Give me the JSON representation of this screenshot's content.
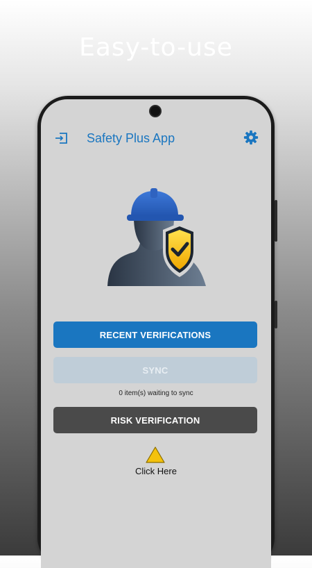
{
  "promo": {
    "headline": "Easy-to-use"
  },
  "app": {
    "title": "Safety Plus App"
  },
  "icons": {
    "left_action": "logout-icon",
    "right_action": "gear-icon",
    "hero": "worker-shield-icon",
    "alert": "warning-icon"
  },
  "buttons": {
    "recent_verifications": "RECENT VERIFICATIONS",
    "sync": "SYNC",
    "risk_verification": "RISK VERIFICATION"
  },
  "sync_status": "0 item(s) waiting to sync",
  "alert": {
    "label": "Click Here"
  },
  "colors": {
    "accent": "#1a76c0",
    "sync_disabled": "#bfcdd8",
    "risk_button": "#4a4a4a",
    "screen_bg": "#d4d4d4",
    "warning": "#f4c20d"
  }
}
